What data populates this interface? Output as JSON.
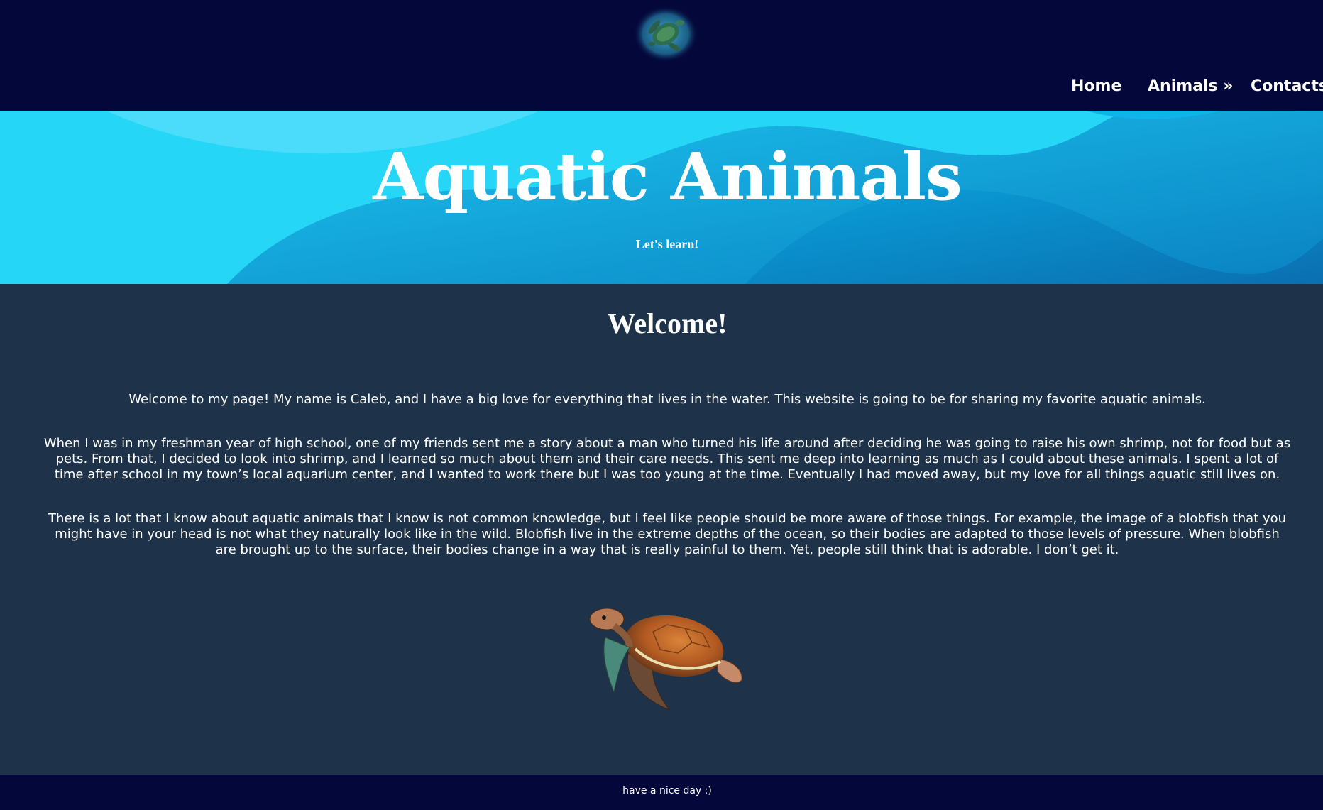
{
  "header": {
    "logo_icon": "turtle-logo-icon",
    "nav": {
      "home": "Home",
      "animals": "Animals »",
      "contacts": "Contacts"
    }
  },
  "hero": {
    "title": "Aquatic Animals",
    "subtitle": "Let's learn!"
  },
  "main": {
    "heading": "Welcome!",
    "paragraphs": [
      "Welcome to my page! My name is Caleb, and I have a big love for everything that lives in the water. This website is going to be for sharing my favorite aquatic animals.",
      "When I was in my freshman year of high school, one of my friends sent me a story about a man who turned his life around after deciding he was going to raise his own shrimp, not for food but as pets. From that, I decided to look into shrimp, and I learned so much about them and their care needs. This sent me deep into learning as much as I could about these animals. I spent a lot of time after school in my town’s local aquarium center, and I wanted to work there but I was too young at the time. Eventually I had moved away, but my love for all things aquatic still lives on.",
      "There is a lot that I know about aquatic animals that I know is not common knowledge, but I feel like people should be more aware of those things. For example, the image of a blobfish that you might have in your head is not what they naturally look like in the wild. Blobfish live in the extreme depths of the ocean, so their bodies are adapted to those levels of pressure. When blobfish are brought up to the surface, their bodies change in a way that is really painful to them. Yet, people still think that is adorable. I don’t get it."
    ],
    "image_icon": "sea-turtle-image"
  },
  "footer": {
    "text": "have a nice day :)"
  },
  "colors": {
    "header_bg": "#04073a",
    "main_bg": "#1e3349",
    "hero_light": "#25d6f7",
    "hero_dark": "#0596cf"
  }
}
